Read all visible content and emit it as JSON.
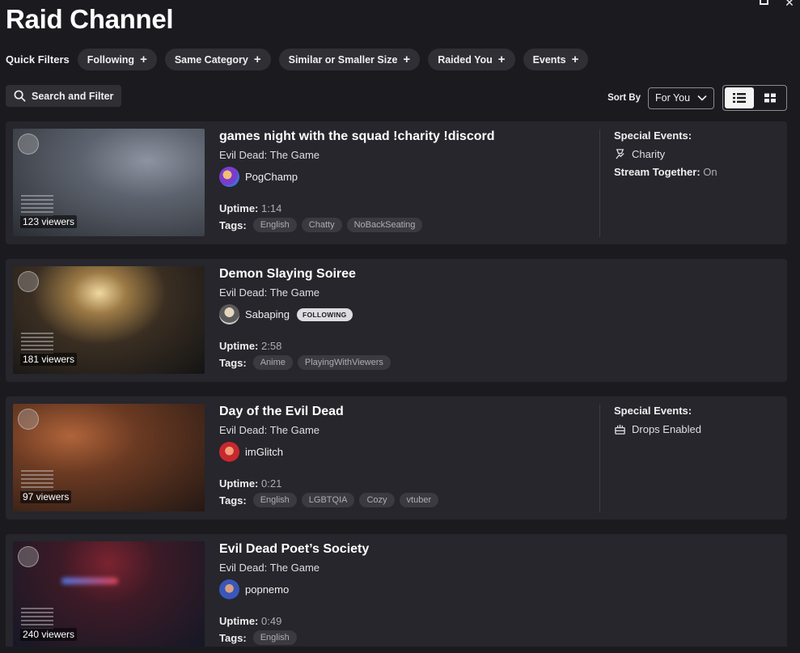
{
  "page_title": "Raid Channel",
  "quick_filters": {
    "label": "Quick Filters",
    "chips": [
      "Following",
      "Same Category",
      "Similar or Smaller Size",
      "Raided You",
      "Events"
    ]
  },
  "search_button": "Search and Filter",
  "sort": {
    "label": "Sort By",
    "selected": "For You"
  },
  "streams": [
    {
      "title": "games night with the squad !charity !discord",
      "category": "Evil Dead: The Game",
      "channel": "PogChamp",
      "following": "",
      "viewers": "123 viewers",
      "uptime_label": "Uptime:",
      "uptime": "1:14",
      "tags_label": "Tags:",
      "tags": [
        "English",
        "Chatty",
        "NoBackSeating"
      ],
      "events_title": "Special Events:",
      "event_item": "Charity",
      "event_icon": "charity-icon",
      "stream_together_label": "Stream Together:",
      "stream_together_value": "On"
    },
    {
      "title": "Demon Slaying Soiree",
      "category": "Evil Dead: The Game",
      "channel": "Sabaping",
      "following": "FOLLOWING",
      "viewers": "181 viewers",
      "uptime_label": "Uptime:",
      "uptime": "2:58",
      "tags_label": "Tags:",
      "tags": [
        "Anime",
        "PlayingWithViewers"
      ]
    },
    {
      "title": "Day of the Evil Dead",
      "category": "Evil Dead: The Game",
      "channel": "imGlitch",
      "following": "",
      "viewers": "97 viewers",
      "uptime_label": "Uptime:",
      "uptime": "0:21",
      "tags_label": "Tags:",
      "tags": [
        "English",
        "LGBTQIA",
        "Cozy",
        "vtuber"
      ],
      "events_title": "Special Events:",
      "event_item": "Drops Enabled",
      "event_icon": "drops-icon"
    },
    {
      "title": "Evil Dead Poet’s Society",
      "category": "Evil Dead: The Game",
      "channel": "popnemo",
      "following": "",
      "viewers": "240 viewers",
      "uptime_label": "Uptime:",
      "uptime": "0:49",
      "tags_label": "Tags:",
      "tags": [
        "English"
      ]
    }
  ],
  "colors": {
    "background": "#1b1b1f",
    "card": "#26262c",
    "chip": "#2f2f35",
    "tag": "#3a3a40",
    "text_muted": "#adadb8"
  }
}
